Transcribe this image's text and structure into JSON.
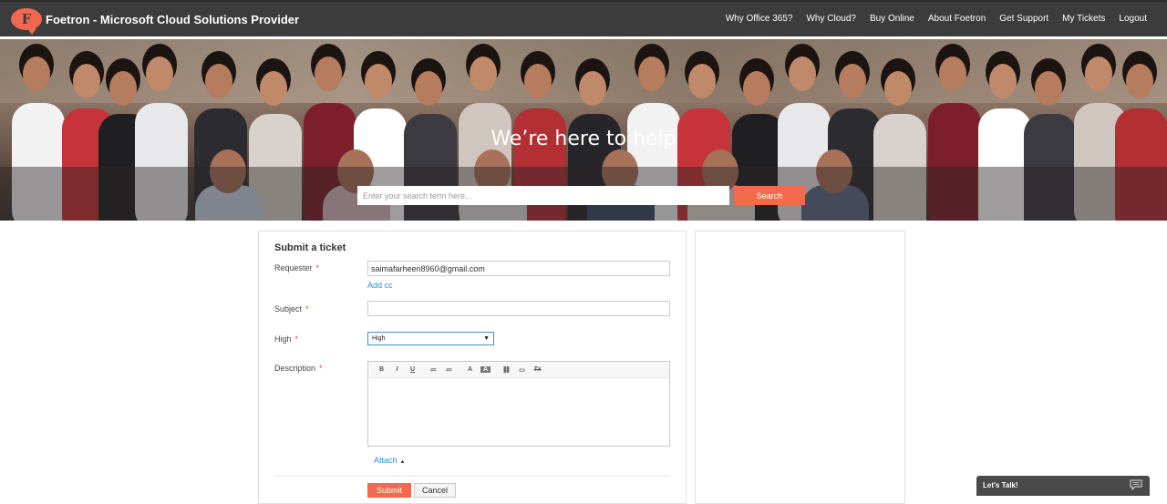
{
  "header": {
    "logo_letter": "F",
    "brand": "Foetron - Microsoft Cloud Solutions Provider",
    "nav": [
      "Why Office 365?",
      "Why Cloud?",
      "Buy Online",
      "About Foetron",
      "Get Support",
      "My Tickets",
      "Logout"
    ]
  },
  "hero": {
    "title": "We’re here to help",
    "search_placeholder": "Enter your search term here...",
    "search_button": "Search"
  },
  "form": {
    "title": "Submit a ticket",
    "requester_label": "Requester",
    "requester_value": "saimafarheen8960@gmail.com",
    "add_cc": "Add cc",
    "subject_label": "Subject",
    "subject_value": "",
    "priority_label": "High",
    "priority_selected": "High",
    "description_label": "Description",
    "required_mark": "*",
    "toolbar": [
      "B",
      "I",
      "U",
      "≔",
      "≔",
      "A",
      "A",
      "⛓",
      "▭",
      "Tx"
    ],
    "attach": "Attach",
    "submit": "Submit",
    "cancel": "Cancel"
  },
  "chat": {
    "label": "Let's Talk!"
  },
  "colors": {
    "accent": "#f26a4b",
    "topbar": "#3c3c3c",
    "link": "#2c8fd0"
  }
}
